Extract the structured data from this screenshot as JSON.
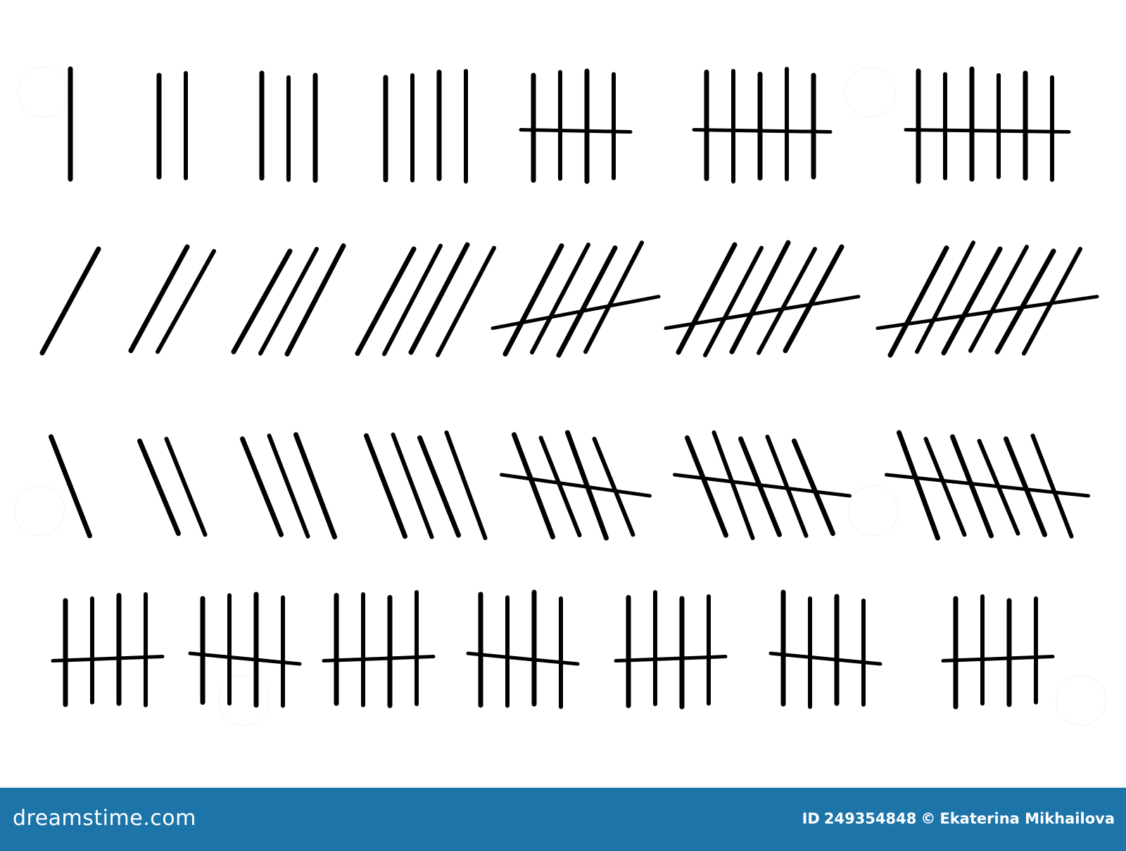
{
  "footer": {
    "brand": "dreamstime.com",
    "id_label": "ID",
    "id_number": "249354848",
    "copyright": "©",
    "author": "Ekaterina Mikhailova",
    "background_color": "#1d74a8"
  },
  "tally_rows": [
    {
      "style": "vertical",
      "counts": [
        1,
        2,
        3,
        4,
        5,
        6,
        7
      ]
    },
    {
      "style": "leaning-back",
      "counts": [
        1,
        2,
        3,
        4,
        5,
        6,
        7
      ]
    },
    {
      "style": "leaning-forward",
      "counts": [
        1,
        2,
        3,
        4,
        5,
        6,
        7
      ]
    },
    {
      "style": "vertical-with-strike",
      "counts": [
        5,
        5,
        5,
        5,
        5,
        5,
        5
      ]
    }
  ]
}
